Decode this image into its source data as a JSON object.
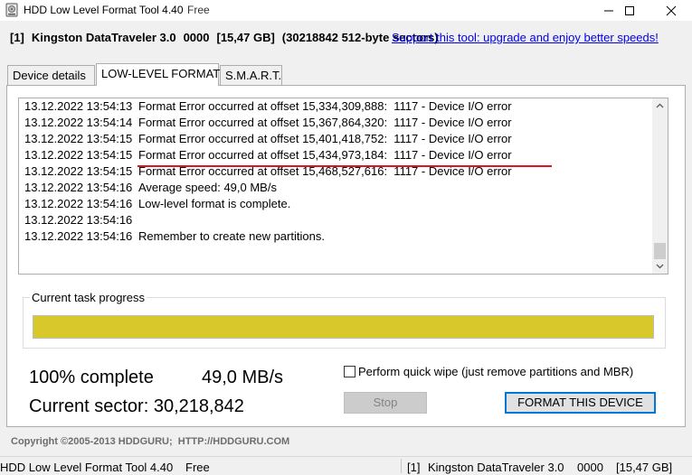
{
  "window": {
    "title": "HDD Low Level Format Tool 4.40",
    "edition": "Free"
  },
  "device_bar": {
    "index": "[1]",
    "model": "Kingston DataTraveler 3.0",
    "code": "0000",
    "capacity": "[15,47 GB]",
    "sectors": "(30218842 512-byte sectors)",
    "upgrade_link": "Support this tool: upgrade and enjoy better speeds!"
  },
  "tabs": [
    {
      "label": "Device details"
    },
    {
      "label": "LOW-LEVEL FORMAT"
    },
    {
      "label": "S.M.A.R.T."
    }
  ],
  "log": [
    {
      "time": "13.12.2022 13:54:13",
      "message": "Format Error occurred at offset 15,334,309,888:  1117 - Device I/O error"
    },
    {
      "time": "13.12.2022 13:54:14",
      "message": "Format Error occurred at offset 15,367,864,320:  1117 - Device I/O error"
    },
    {
      "time": "13.12.2022 13:54:15",
      "message": "Format Error occurred at offset 15,401,418,752:  1117 - Device I/O error"
    },
    {
      "time": "13.12.2022 13:54:15",
      "message": "Format Error occurred at offset 15,434,973,184:  1117 - Device I/O error"
    },
    {
      "time": "13.12.2022 13:54:15",
      "message": "Format Error occurred at offset 15,468,527,616:  1117 - Device I/O error"
    },
    {
      "time": "13.12.2022 13:54:16",
      "message": "Average speed: 49,0 MB/s"
    },
    {
      "time": "13.12.2022 13:54:16",
      "message": "Low-level format is complete."
    },
    {
      "time": "13.12.2022 13:54:16",
      "message": ""
    },
    {
      "time": "13.12.2022 13:54:16",
      "message": "Remember to create new partitions."
    }
  ],
  "highlight_color": "#e0141e",
  "progress": {
    "label": "Current task progress",
    "fraction": 1.0,
    "fill_color": "#d9c82c"
  },
  "stats": {
    "complete": "100% complete",
    "speed": "49,0 MB/s",
    "sector": "Current sector: 30,218,842"
  },
  "options": {
    "quick_wipe_label": "Perform quick wipe (just remove partitions and MBR)",
    "quick_wipe_checked": false
  },
  "buttons": {
    "stop": "Stop",
    "format": "FORMAT THIS DEVICE"
  },
  "copyright": "Copyright ©2005-2013 HDDGURU;  HTTP://HDDGURU.COM",
  "statusbar": {
    "app": "HDD Low Level Format Tool 4.40",
    "edition": "Free",
    "index": "[1]",
    "model": "Kingston DataTraveler 3.0",
    "code": "0000",
    "capacity": "[15,47 GB]"
  }
}
